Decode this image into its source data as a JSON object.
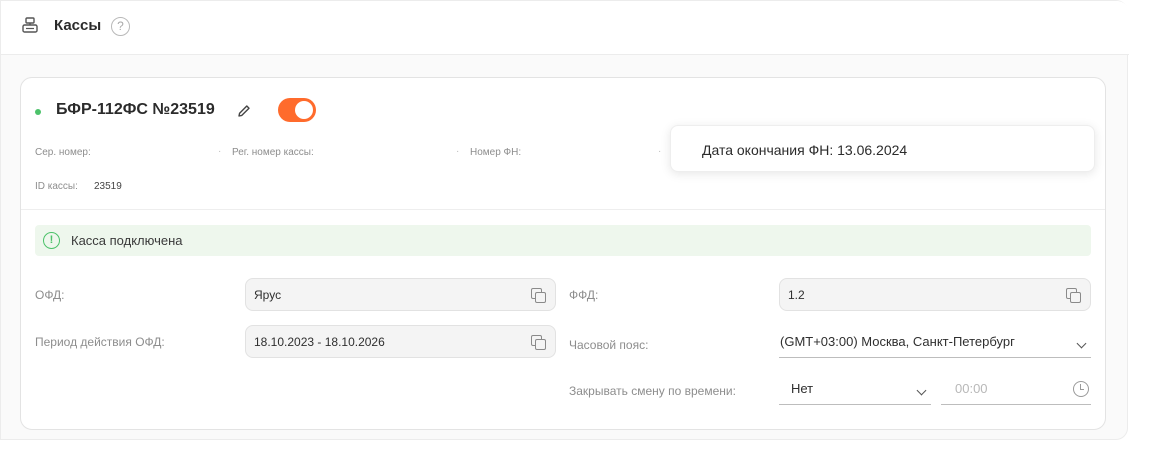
{
  "header": {
    "title": "Кассы",
    "help_glyph": "?"
  },
  "kassa": {
    "name": "БФР-112ФС №23519",
    "status_color": "#4cc26a",
    "toggle_on": true,
    "toggle_color": "#ff6b2c",
    "serial_label": "Сер. номер:",
    "reg_label": "Рег. номер кассы:",
    "fn_label": "Номер ФН:",
    "id_label": "ID кассы:",
    "id_value": "23519",
    "separator": "·"
  },
  "fn_popup": {
    "text": "Дата окончания ФН: 13.06.2024"
  },
  "status": {
    "text": "Касса подключена",
    "icon_glyph": "!"
  },
  "form": {
    "ofd_label": "ОФД:",
    "ofd_value": "Ярус",
    "ffd_label": "ФФД:",
    "ffd_value": "1.2",
    "period_label": "Период действия ОФД:",
    "period_value": "18.10.2023 - 18.10.2026",
    "timezone_label": "Часовой пояс:",
    "timezone_value": "(GMT+03:00) Москва, Санкт-Петербург",
    "close_shift_label": "Закрывать смену по времени:",
    "close_shift_value": "Нет",
    "close_time_value": "00:00"
  },
  "icons": [
    "cash-register-icon",
    "help-icon",
    "edit-icon",
    "info-icon",
    "copy-icon",
    "chevron-down-icon",
    "clock-icon"
  ]
}
